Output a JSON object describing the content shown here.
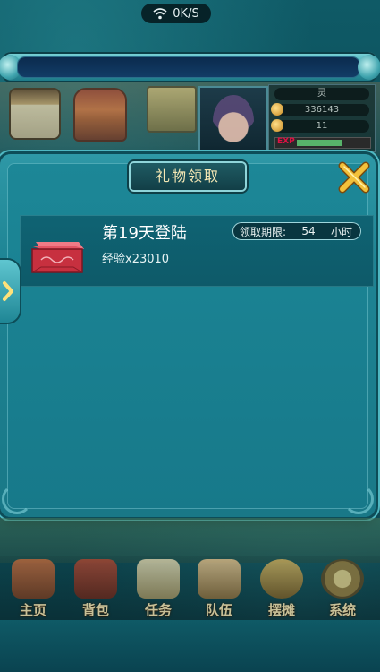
{
  "status": {
    "speed": "0K/S"
  },
  "hud": {
    "spirit_label": "灵",
    "stat_1": "336143",
    "stat_2": "11",
    "exp_label": "EXP",
    "exp_progress": 0.62
  },
  "dialog": {
    "title": "礼物领取",
    "gift": {
      "title": "第19天登陆",
      "reward": "经验x23010",
      "deadline_label": "领取期限:",
      "deadline_value": "54",
      "deadline_unit": "小时"
    }
  },
  "nav": {
    "items": [
      {
        "label": "主页",
        "icon": "home-icon"
      },
      {
        "label": "背包",
        "icon": "bag-icon"
      },
      {
        "label": "任务",
        "icon": "scroll-icon"
      },
      {
        "label": "队伍",
        "icon": "team-icon"
      },
      {
        "label": "摆摊",
        "icon": "stall-icon"
      },
      {
        "label": "系统",
        "icon": "gear-icon"
      }
    ]
  },
  "colors": {
    "dialog_bg": "#1e8494",
    "gift_row_bg": "#0f6373",
    "close_icon": "#f3c13b",
    "title_text": "#f4e7b4"
  }
}
